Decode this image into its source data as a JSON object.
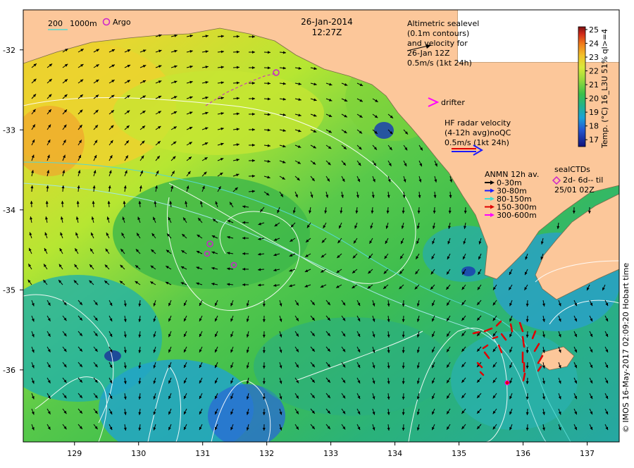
{
  "title": {
    "date": "26-Jan-2014",
    "time": "12:27Z"
  },
  "isobath_legend": {
    "shallow": "200",
    "deep": "1000m",
    "argo": "Argo"
  },
  "altimetry_note": {
    "lines": [
      "Altimetric sealevel",
      "(0.1m contours)",
      "and velocity for",
      "26-Jan 12Z",
      "0.5m/s (1kt 24h)"
    ]
  },
  "drifter_label": "drifter",
  "hf_radar": {
    "lines": [
      "HF radar velocity",
      "(4-12h avg)noQC",
      "0.5m/s (1kt 24h)"
    ]
  },
  "anmn": {
    "title": "ANMN 12h av.",
    "items": [
      {
        "label": "0-30m",
        "color": "#000000"
      },
      {
        "label": "30-80m",
        "color": "#1a1aff"
      },
      {
        "label": "80-150m",
        "color": "#40e0d0"
      },
      {
        "label": "150-300m",
        "color": "#e00000"
      },
      {
        "label": "300-600m",
        "color": "#ff00ff"
      }
    ]
  },
  "seal_ctds": {
    "title": "sealCTDs",
    "line2": "2d- 6d-- til",
    "line3": "25/01 02Z"
  },
  "colorbar": {
    "label": "Temp. (°C) 16_L3U 51% ql>=4",
    "ticks": [
      "25",
      "24",
      "23",
      "22",
      "21",
      "20",
      "19",
      "18",
      "17"
    ],
    "min": 16.5,
    "max": 25.2
  },
  "credit": "© IMOS 16-May-2017 02:09:20 Hobart time",
  "axes": {
    "x_ticks": [
      "129",
      "130",
      "131",
      "132",
      "133",
      "134",
      "135",
      "136",
      "137"
    ],
    "y_ticks": [
      "-32",
      "-33",
      "-34",
      "-35",
      "-36"
    ],
    "lon_range": [
      128.2,
      137.5
    ],
    "lat_range": [
      -31.5,
      -36.9
    ]
  },
  "colors": {
    "land": "#fcc79a",
    "arrow": "#000000",
    "hf_arrow": "#e00000",
    "argo": "#cc22cc",
    "contour": "#ffffff",
    "isobath_200": "#56d8d0",
    "isobath_1000": "#a0e6e6"
  }
}
